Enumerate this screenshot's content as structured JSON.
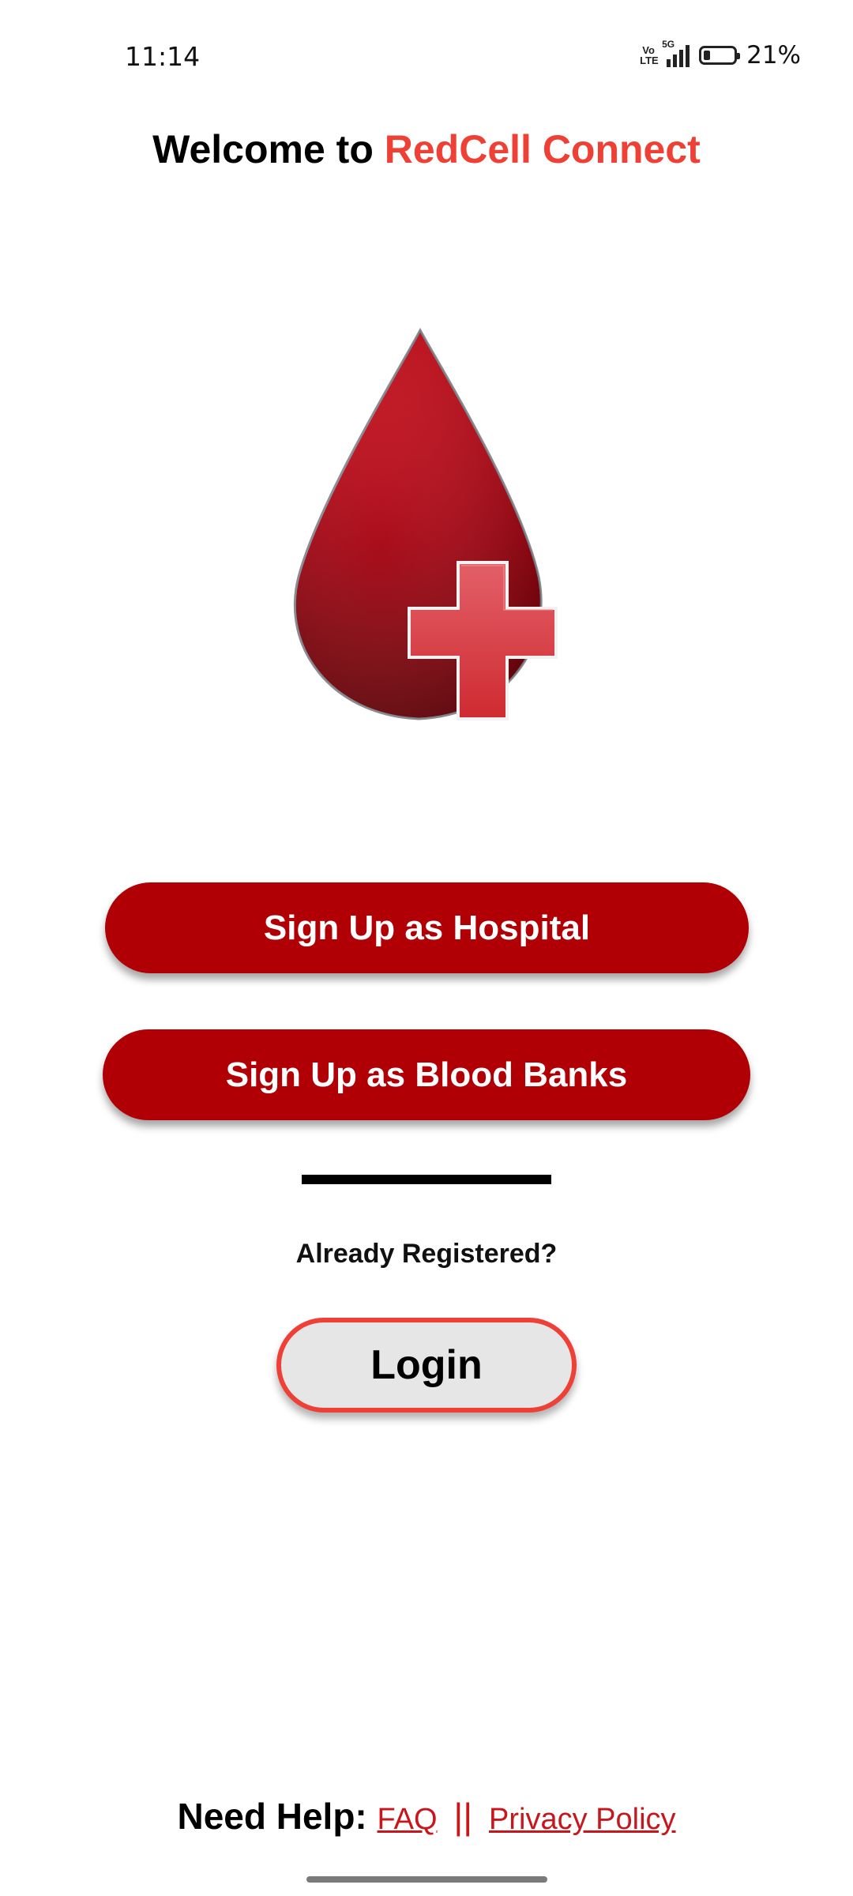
{
  "status_bar": {
    "time": "11:14",
    "volte_line1": "Vo",
    "volte_line2": "LTE",
    "network": "5G",
    "battery_percent": "21%",
    "battery_level": 0.21
  },
  "header": {
    "welcome_prefix": "Welcome to ",
    "brand_name": "RedCell Connect"
  },
  "logo": {
    "icon": "blood-drop-plus-icon"
  },
  "actions": {
    "signup_hospital_label": "Sign Up as Hospital",
    "signup_bloodbank_label": "Sign Up as Blood Banks"
  },
  "login_section": {
    "prompt": "Already Registered?",
    "login_label": "Login"
  },
  "footer": {
    "help_label": "Need Help:",
    "faq_label": "FAQ",
    "separator": "||",
    "privacy_label": "Privacy Policy"
  },
  "colors": {
    "brand_red": "#ef4036",
    "button_red": "#b00005",
    "link_red": "#c8161d"
  }
}
